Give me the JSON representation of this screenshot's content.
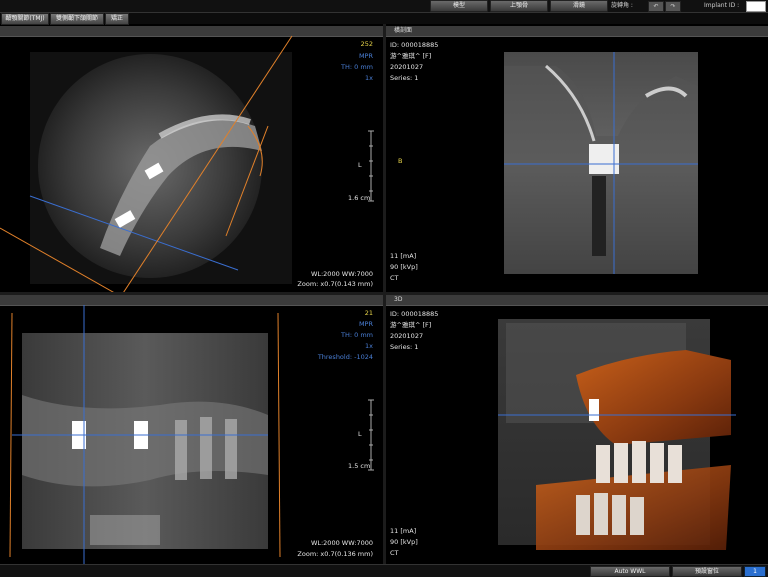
{
  "toolbar": {
    "buttons": [
      "模型",
      "上顎骨",
      "滑鏡"
    ],
    "rotate_label": "旋轉角 :",
    "implant_id_label": "Implant ID :"
  },
  "tabs": [
    "顳顎關節(TMJ)",
    "雙側顳下頜關節",
    "矯正"
  ],
  "panes": {
    "top_left": {
      "slice": "252",
      "mode": "MPR",
      "thickness": "TH: 0 mm",
      "zoom_factor": "1x",
      "ruler_label": "L",
      "ruler_value": "1.6 cm",
      "window": "WL:2000 WW:7000",
      "zoom": "Zoom: x0.7(0.143 mm)"
    },
    "top_right": {
      "title": "橫剖面",
      "patient_id": "ID: 000018885",
      "patient_name": "游^雅琪^ [F]",
      "date": "20201027",
      "series": "Series: 1",
      "marker": "B",
      "ma": "11 [mA]",
      "kvp": "90 [kVp]",
      "modality": "CT"
    },
    "bottom_left": {
      "slice": "21",
      "mode": "MPR",
      "thickness": "TH: 0 mm",
      "zoom_factor": "1x",
      "threshold": "Threshold: -1024",
      "ruler_label": "L",
      "ruler_value": "1.5 cm",
      "window": "WL:2000 WW:7000",
      "zoom": "Zoom: x0.7(0.136 mm)"
    },
    "bottom_right": {
      "title": "3D",
      "patient_id": "ID: 000018885",
      "patient_name": "游^雅琪^ [F]",
      "date": "20201027",
      "series": "Series: 1",
      "ma": "11 [mA]",
      "kvp": "90 [kVp]",
      "modality": "CT"
    }
  },
  "bottombar": {
    "auto_wwl": "Auto WWL",
    "preset": "預設窗位",
    "page": "1"
  }
}
